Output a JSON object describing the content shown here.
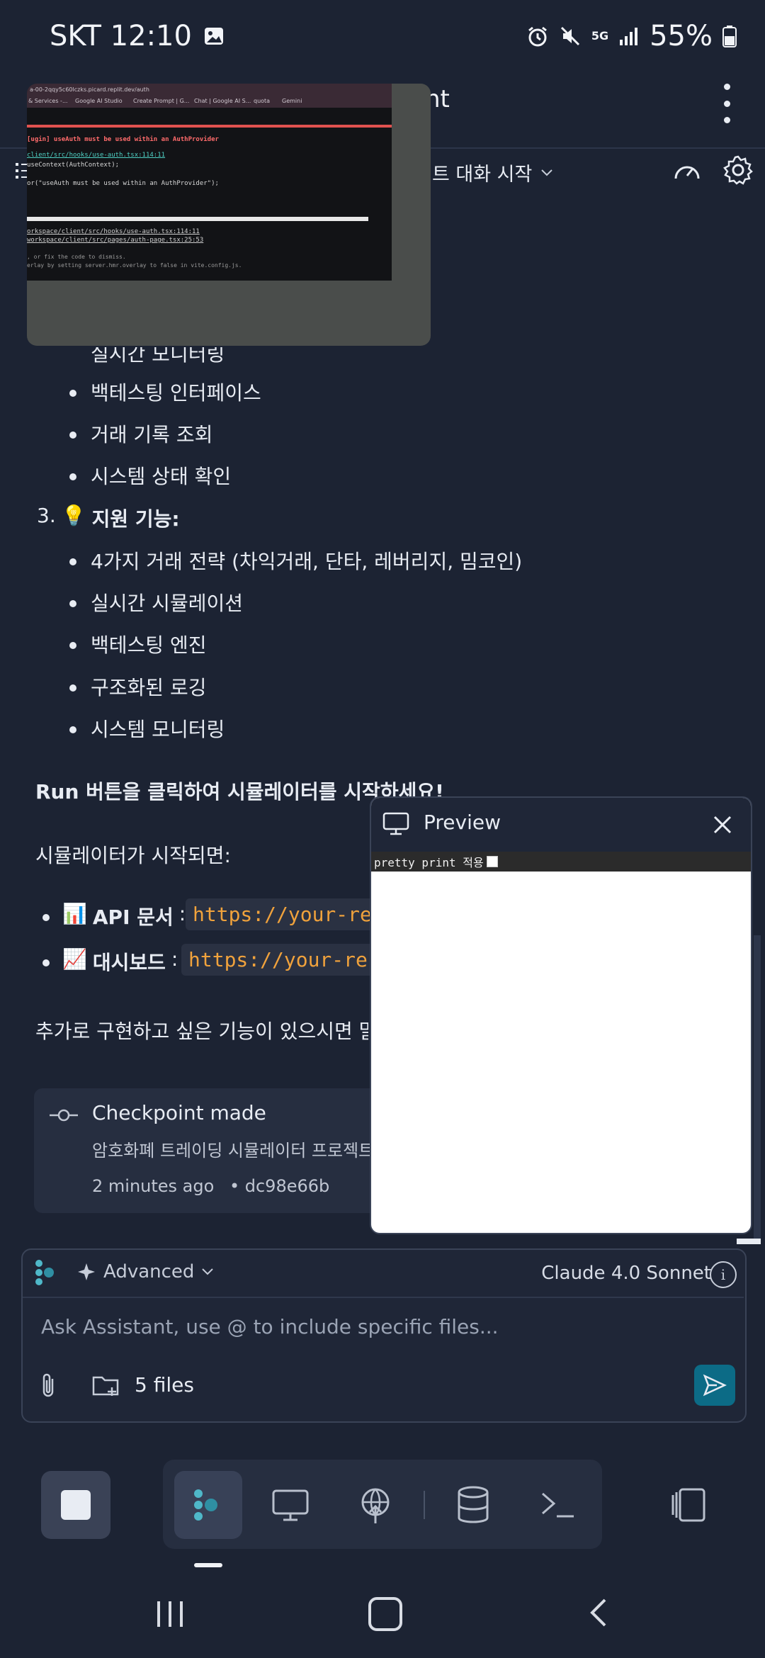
{
  "status_bar": {
    "carrier_time": "SKT 12:10",
    "network": "5G",
    "battery": "55%",
    "icons": [
      "image-icon",
      "alarm-icon",
      "mute-icon",
      "signal-icon",
      "battery-icon"
    ]
  },
  "header": {
    "title_fragment": "nt",
    "chat_title_fragment": "트 대화 시작"
  },
  "pip": {
    "url": "a-00-2qqy5c60lczks.picard.replit.dev/auth",
    "tabs": [
      "& Services -...",
      "Google AI Studio",
      "Create Prompt | G...",
      "Chat | Google AI S...",
      "quota",
      "Gemini"
    ],
    "error_title": "[ugin] useAuth must be used within an AuthProvider",
    "error_link": "client/src/hooks/use-auth.tsx:114:11",
    "code_line1": "useContext(AuthContext);",
    "code_line2": "or(\"useAuth must be used within an AuthProvider\");",
    "stack1": "orkspace/client/src/hooks/use-auth.tsx:114:11",
    "stack2": "workspace/client/src/pages/auth-page.tsx:25:53",
    "hint1": ", or fix the code to dismiss.",
    "hint2": "erlay by setting server.hmr.overlay to false in vite.config.js."
  },
  "content": {
    "partial_item": "실시간 모니터링",
    "items_2": [
      "백테스팅 인터페이스",
      "거래 기록 조회",
      "시스템 상태 확인"
    ],
    "section3_number": "3.",
    "section3_emoji": "💡",
    "section3_title": "지원 기능:",
    "items_3": [
      "4가지 거래 전략 (차익거래, 단타, 레버리지, 밈코인)",
      "실시간 시뮬레이션",
      "백테스팅 엔진",
      "구조화된 로깅",
      "시스템 모니터링"
    ],
    "run_text": "Run 버튼을 클릭하여 시뮬레이터를 시작하세요!",
    "started_text": "시뮬레이터가 시작되면:",
    "links": [
      {
        "emoji": "📊",
        "label": "API 문서",
        "colon": ":",
        "url": "https://your-re"
      },
      {
        "emoji": "📈",
        "label": "대시보드",
        "colon": ":",
        "url": "https://your-re"
      }
    ],
    "extra_text": "추가로 구현하고 싶은 기능이 있으시면 말"
  },
  "checkpoint": {
    "title": "Checkpoint made",
    "description": "암호화폐 트레이딩 시뮬레이터 프로젝트",
    "time": "2 minutes ago",
    "hash": "• dc98e66b"
  },
  "preview": {
    "title": "Preview",
    "pretty_print_label": "pretty print 적용"
  },
  "composer": {
    "mode": "Advanced",
    "model": "Claude 4.0 Sonnet",
    "placeholder": "Ask Assistant, use @ to include specific files...",
    "files": "5 files"
  },
  "colors": {
    "background": "#1c2333",
    "accent": "#0c6b86",
    "code": "#f0a23c",
    "error": "#e0524f"
  }
}
